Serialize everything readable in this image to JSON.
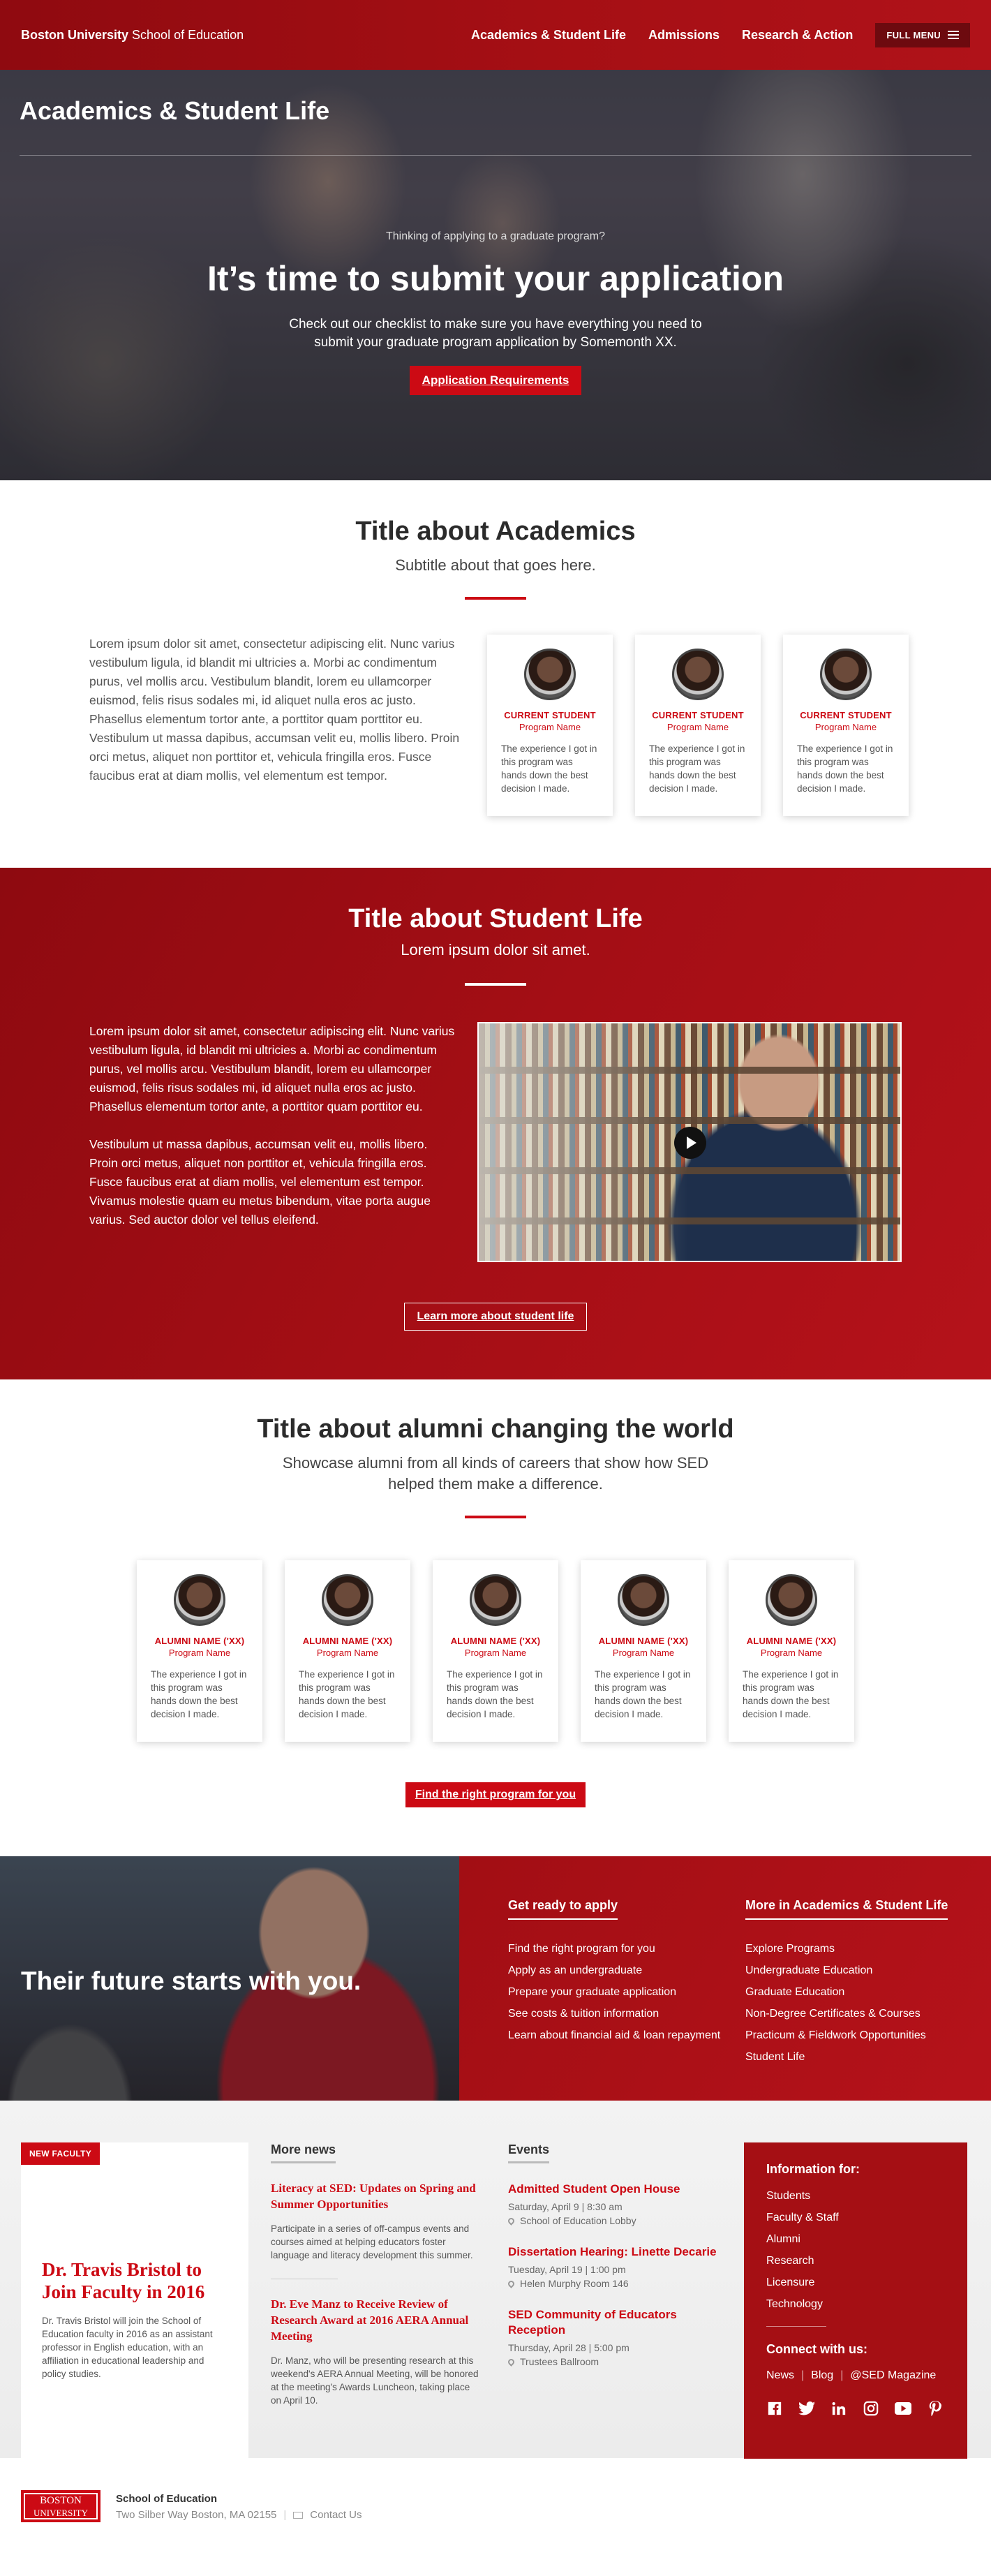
{
  "header": {
    "brand_bold": "Boston University",
    "brand_rest": " School of Education",
    "nav": [
      "Academics & Student Life",
      "Admissions",
      "Research & Action"
    ],
    "menu_label": "FULL MENU"
  },
  "hero": {
    "section_title": "Academics & Student Life",
    "eyebrow": "Thinking of applying to a graduate program?",
    "headline": "It’s time to submit your application",
    "text": "Check out our checklist to make sure you have everything you need to submit your graduate program application by Somemonth XX.",
    "button": "Application Requirements"
  },
  "academics": {
    "title": "Title about Academics",
    "subtitle": "Subtitle about that goes here.",
    "body": "Lorem ipsum dolor sit amet, consectetur adipiscing elit. Nunc varius vestibulum ligula, id blandit mi ultricies a. Morbi ac condimentum purus, vel mollis arcu. Vestibulum blandit, lorem eu ullamcorper euismod, felis risus sodales mi, id aliquet nulla eros ac justo. Phasellus elementum tortor ante, a porttitor quam porttitor eu. Vestibulum ut massa dapibus, accumsan velit eu, mollis libero. Proin orci metus, aliquet non porttitor et, vehicula fringilla eros. Fusce faucibus erat at diam mollis, vel elementum est tempor.",
    "cards": [
      {
        "title": "CURRENT STUDENT",
        "program": "Program Name",
        "text": "The experience I got in this program was hands down the best decision I made."
      },
      {
        "title": "CURRENT STUDENT",
        "program": "Program Name",
        "text": "The experience I got in this program was hands down the best decision I made."
      },
      {
        "title": "CURRENT STUDENT",
        "program": "Program Name",
        "text": "The experience I got in this program was hands down the best decision I made."
      }
    ]
  },
  "student_life": {
    "title": "Title about Student Life",
    "subtitle": "Lorem ipsum dolor sit amet.",
    "para1": "Lorem ipsum dolor sit amet, consectetur adipiscing elit. Nunc varius vestibulum ligula, id blandit mi ultricies a. Morbi ac condimentum purus, vel mollis arcu. Vestibulum blandit, lorem eu ullamcorper euismod, felis risus sodales mi, id aliquet nulla eros ac justo. Phasellus elementum tortor ante, a porttitor quam porttitor eu.",
    "para2": "Vestibulum ut massa dapibus, accumsan velit eu, mollis libero. Proin orci metus, aliquet non porttitor et, vehicula fringilla eros. Fusce faucibus erat at diam mollis, vel elementum est tempor. Vivamus molestie quam eu metus bibendum, vitae porta augue varius. Sed auctor dolor vel tellus eleifend.",
    "button": "Learn more about student life"
  },
  "alumni": {
    "title": "Title about alumni changing the world",
    "subtitle": "Showcase alumni from all kinds of careers that show how SED helped them make a difference.",
    "cards": [
      {
        "title": "ALUMNI NAME ('XX)",
        "program": "Program Name",
        "text": "The experience I got in this program was hands down the best decision I made."
      },
      {
        "title": "ALUMNI NAME ('XX)",
        "program": "Program Name",
        "text": "The experience I got in this program was hands down the best decision I made."
      },
      {
        "title": "ALUMNI NAME ('XX)",
        "program": "Program Name",
        "text": "The experience I got in this program was hands down the best decision I made."
      },
      {
        "title": "ALUMNI NAME ('XX)",
        "program": "Program Name",
        "text": "The experience I got in this program was hands down the best decision I made."
      },
      {
        "title": "ALUMNI NAME ('XX)",
        "program": "Program Name",
        "text": "The experience I got in this program was hands down the best decision I made."
      }
    ],
    "button": "Find the right program for you"
  },
  "future": {
    "title": "Their future starts with you.",
    "col1_title": "Get ready to apply",
    "col1_links": [
      "Find the right program for you",
      "Apply as an undergraduate",
      "Prepare your graduate application",
      "See costs & tuition information",
      "Learn about financial aid & loan repayment"
    ],
    "col2_title": "More in Academics & Student Life",
    "col2_links": [
      "Explore Programs",
      "Undergraduate Education",
      "Graduate Education",
      "Non-Degree Certificates & Courses",
      "Practicum & Fieldwork Opportunities",
      "Student Life"
    ]
  },
  "feature": {
    "tag": "NEW FACULTY",
    "title": "Dr. Travis Bristol to Join Faculty in 2016",
    "text": "Dr. Travis Bristol will join the School of Education faculty in 2016 as an assistant professor in English education, with an affiliation in educational leadership and policy studies."
  },
  "news": {
    "heading": "More news",
    "items": [
      {
        "title": "Literacy at SED: Updates on Spring and Summer Opportunities",
        "text": "Participate in a series of off-campus events and courses aimed at helping educators foster language and literacy development this summer."
      },
      {
        "title": "Dr. Eve Manz to Receive Review of Research Award at 2016 AERA Annual Meeting",
        "text": "Dr. Manz, who will be presenting research at this weekend's AERA Annual Meeting, will be honored at the meeting's Awards Luncheon, taking place on April 10."
      }
    ]
  },
  "events": {
    "heading": "Events",
    "items": [
      {
        "title": "Admitted Student Open House",
        "when": "Saturday, April 9 | 8:30 am",
        "where": "School of Education Lobby"
      },
      {
        "title": "Dissertation Hearing: Linette Decarie",
        "when": "Tuesday, April 19 | 1:00 pm",
        "where": "Helen Murphy Room 146"
      },
      {
        "title": "SED Community of Educators Reception",
        "when": "Thursday, April 28 | 5:00 pm",
        "where": "Trustees Ballroom"
      }
    ]
  },
  "info": {
    "heading": "Information for:",
    "links": [
      "Students",
      "Faculty & Staff",
      "Alumni",
      "Research",
      "Licensure",
      "Technology"
    ],
    "connect_heading": "Connect with us:",
    "social_text": [
      "News",
      "Blog",
      "@SED Magazine"
    ],
    "social_icons": [
      "facebook-icon",
      "twitter-icon",
      "linkedin-icon",
      "instagram-icon",
      "youtube-icon",
      "pinterest-icon"
    ]
  },
  "footer": {
    "logo_line1": "BOSTON",
    "logo_line2": "UNIVERSITY",
    "school": "School of Education",
    "address": "Two Silber Way Boston, MA 02155",
    "contact": "Contact Us"
  },
  "colors": {
    "brand_red": "#cc0a14",
    "dark_red": "#a50f14"
  }
}
